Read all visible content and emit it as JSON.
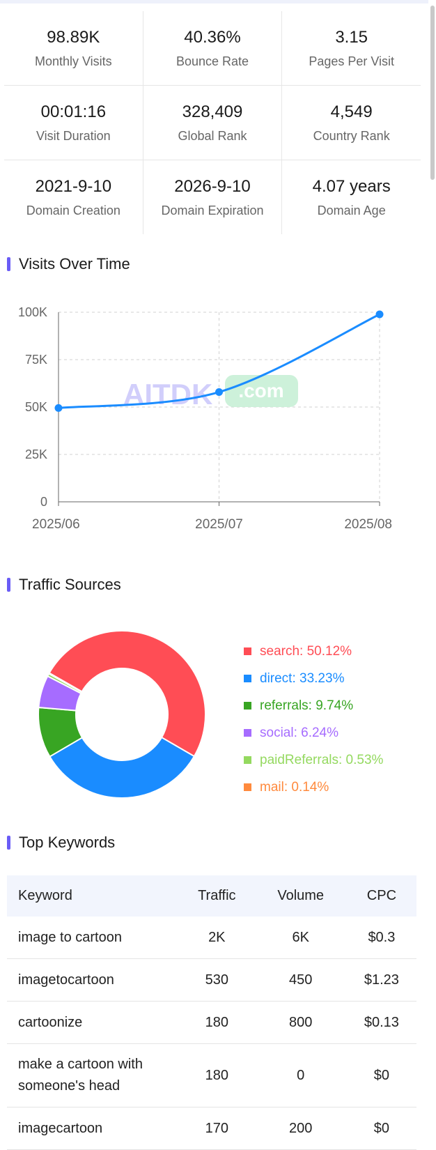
{
  "stats": [
    [
      {
        "value": "98.89K",
        "label": "Monthly Visits"
      },
      {
        "value": "40.36%",
        "label": "Bounce Rate"
      },
      {
        "value": "3.15",
        "label": "Pages Per Visit"
      }
    ],
    [
      {
        "value": "00:01:16",
        "label": "Visit Duration"
      },
      {
        "value": "328,409",
        "label": "Global Rank"
      },
      {
        "value": "4,549",
        "label": "Country Rank"
      }
    ],
    [
      {
        "value": "2021-9-10",
        "label": "Domain Creation"
      },
      {
        "value": "2026-9-10",
        "label": "Domain Expiration"
      },
      {
        "value": "4.07 years",
        "label": "Domain Age"
      }
    ]
  ],
  "sections": {
    "visits_title": "Visits Over Time",
    "traffic_title": "Traffic Sources",
    "keywords_title": "Top Keywords"
  },
  "watermark": {
    "text": "AITDK",
    "badge": ".com"
  },
  "chart_data": [
    {
      "type": "line",
      "title": "Visits Over Time",
      "categories": [
        "2025/06",
        "2025/07",
        "2025/08"
      ],
      "values": [
        49500,
        57900,
        98890
      ],
      "y_ticks": [
        "0",
        "25K",
        "50K",
        "75K",
        "100K"
      ],
      "ylim": [
        0,
        100000
      ],
      "grid": true,
      "color": "#1a8cff"
    },
    {
      "type": "pie",
      "title": "Traffic Sources",
      "series": [
        {
          "name": "search",
          "value": 50.12,
          "label": "search: 50.12%",
          "color": "#ff4d55"
        },
        {
          "name": "direct",
          "value": 33.23,
          "label": "direct: 33.23%",
          "color": "#1a8cff"
        },
        {
          "name": "referrals",
          "value": 9.74,
          "label": "referrals: 9.74%",
          "color": "#38a523"
        },
        {
          "name": "social",
          "value": 6.24,
          "label": "social: 6.24%",
          "color": "#a66cff"
        },
        {
          "name": "paidReferrals",
          "value": 0.53,
          "label": "paidReferrals: 0.53%",
          "color": "#94d95f"
        },
        {
          "name": "mail",
          "value": 0.14,
          "label": "mail: 0.14%",
          "color": "#ff8a3d"
        }
      ]
    }
  ],
  "keywords": {
    "headers": [
      "Keyword",
      "Traffic",
      "Volume",
      "CPC"
    ],
    "rows": [
      [
        "image to cartoon",
        "2K",
        "6K",
        "$0.3"
      ],
      [
        "imagetocartoon",
        "530",
        "450",
        "$1.23"
      ],
      [
        "cartoonize",
        "180",
        "800",
        "$0.13"
      ],
      [
        "make a cartoon with someone's head",
        "180",
        "0",
        "$0"
      ],
      [
        "imagecartoon",
        "170",
        "200",
        "$0"
      ]
    ]
  }
}
